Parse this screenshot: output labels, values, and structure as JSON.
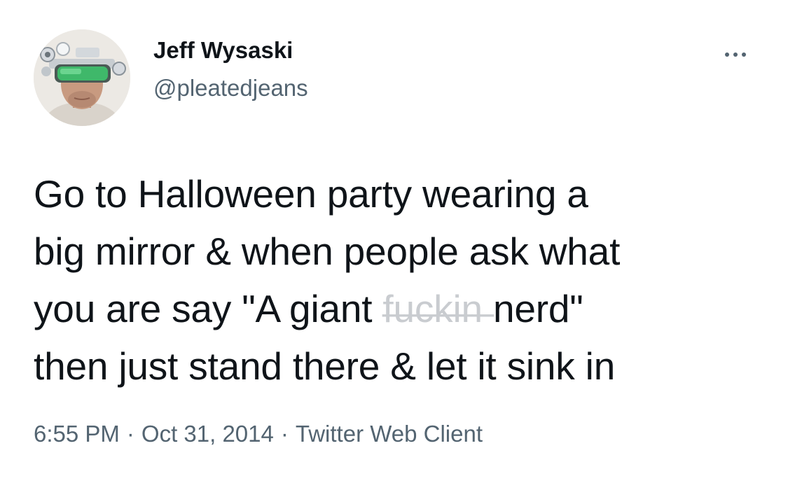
{
  "author": {
    "display_name": "Jeff Wysaski",
    "handle": "@pleatedjeans",
    "avatar_icon": "profile-photo-goggles"
  },
  "menu": {
    "icon": "more-horizontal-icon"
  },
  "tweet": {
    "lines": [
      "Go to Halloween party wearing a",
      "big mirror & when people ask what",
      "you are say \"A giant ",
      "then just stand there & let it sink in"
    ],
    "censored_word": "f̶u̶c̶k̶i̶n̶",
    "line3_tail": " nerd\""
  },
  "meta": {
    "time": "6:55 PM",
    "separator": "·",
    "date": "Oct 31, 2014",
    "source": "Twitter Web Client"
  },
  "colors": {
    "text": "#0f1419",
    "secondary": "#536471",
    "background": "#ffffff"
  }
}
